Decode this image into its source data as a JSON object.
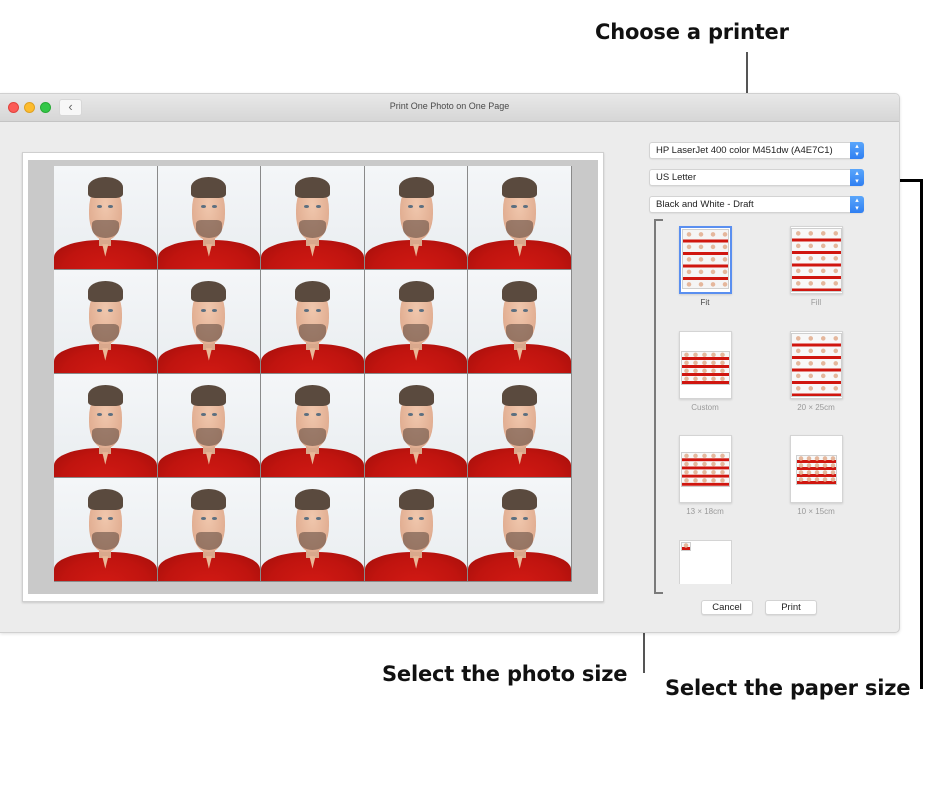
{
  "window": {
    "title": "Print One Photo on One Page",
    "back_button_icon": "chevron-left-icon",
    "back_button_glyph": "‹"
  },
  "preview": {
    "rows": 4,
    "columns": 5,
    "photo_description": "Passport-style portrait of a man in a red polo shirt"
  },
  "controls": {
    "printer": {
      "value": "HP LaserJet 400 color M451dw (A4E7C1)",
      "stepper_glyph": "⌃⌄"
    },
    "paper_size": {
      "value": "US Letter",
      "stepper_glyph": "⌃⌄"
    },
    "quality": {
      "value": "Black and White - Draft",
      "stepper_glyph": "⌃⌄"
    }
  },
  "photo_sizes": [
    {
      "label": "Fit",
      "selected": true
    },
    {
      "label": "Fill",
      "selected": false
    },
    {
      "label": "Custom",
      "selected": false
    },
    {
      "label": "20 × 25cm",
      "selected": false
    },
    {
      "label": "13 × 18cm",
      "selected": false
    },
    {
      "label": "10 × 15cm",
      "selected": false
    },
    {
      "label": "",
      "selected": false
    }
  ],
  "buttons": {
    "cancel": "Cancel",
    "print": "Print"
  },
  "callouts": {
    "printer": "Choose a printer",
    "photo_size": "Select the photo size",
    "paper_size": "Select the paper size"
  },
  "colors": {
    "accent": "#3b87f5",
    "selected_border": "#5a8ff0",
    "close": "#fc5b57",
    "minimize": "#fdbc2e",
    "maximize": "#33c748"
  }
}
